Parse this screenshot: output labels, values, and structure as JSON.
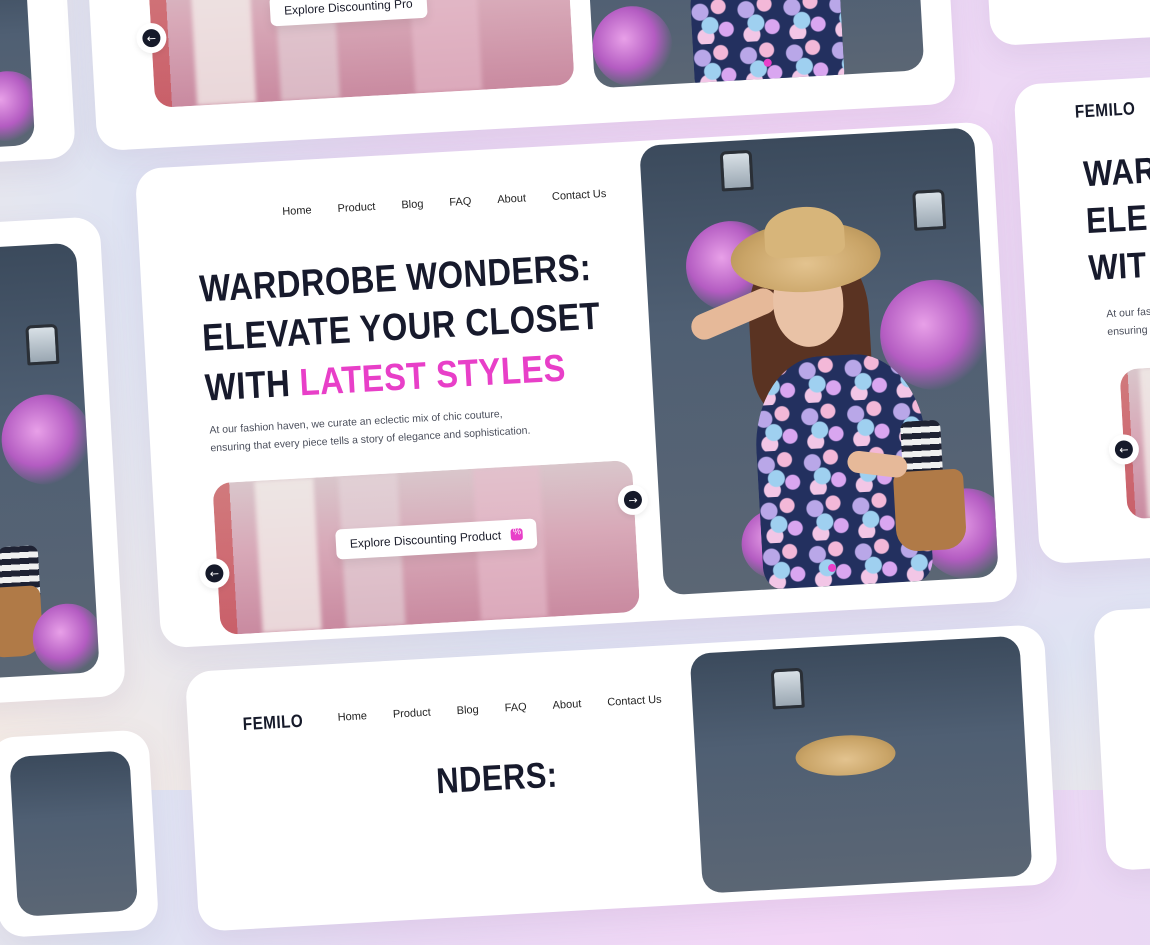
{
  "brand": {
    "logo": "FEMILO"
  },
  "nav": {
    "items": [
      "Home",
      "Product",
      "Blog",
      "FAQ",
      "About",
      "Contact Us"
    ]
  },
  "hero": {
    "line1": "WARDROBE WONDERS:",
    "line2": "ELEVATE YOUR CLOSET",
    "line3_prefix": "WITH ",
    "line3_accent": "LATEST STYLES",
    "description_line1": "At our fashion haven, we curate an eclectic mix of chic couture,",
    "description_line2": "ensuring that every piece tells a story of elegance and sophistication."
  },
  "promo": {
    "button_label": "Explore Discounting Product",
    "top_card_button_label": "Explore Discounting Pro"
  },
  "right_card": {
    "headline_fragment_1": "WAR",
    "headline_fragment_2": "ELE",
    "headline_fragment_3": "WIT",
    "desc_fragment_1": "At our fas",
    "desc_fragment_2": "ensuring"
  },
  "bottom_card": {
    "headline_fragment": "NDERS:"
  },
  "icons": {
    "prev": "←",
    "next": "→"
  },
  "colors": {
    "accent": "#e83fc8",
    "text_dark": "#171a2c",
    "card_bg": "#ffffff"
  }
}
